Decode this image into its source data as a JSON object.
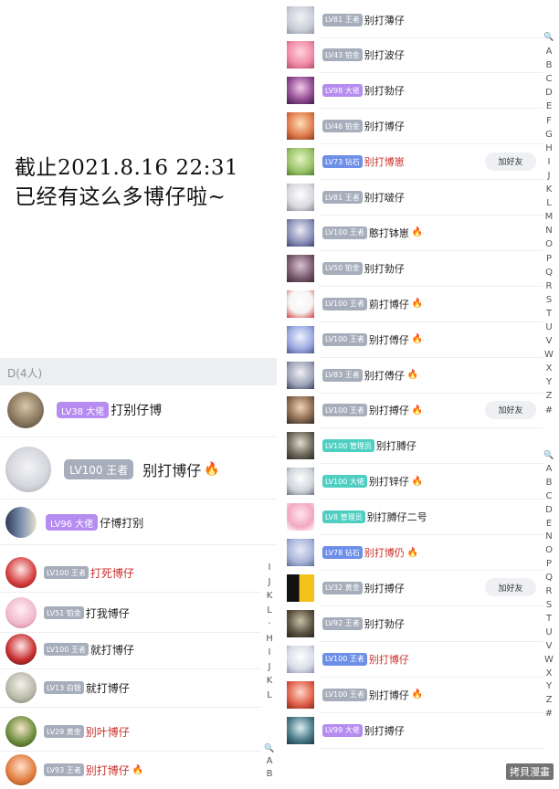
{
  "caption": {
    "line1": "截止2021.8.16 22:31",
    "line2": "已经有这么多博仔啦~"
  },
  "section_header": "D(4人)",
  "colors": {
    "purple": "#b78cf0",
    "gray": "#a6adbb",
    "teal": "#4fcfc2",
    "blue": "#6d8fe8",
    "red_name": "#c9302c"
  },
  "left_big_members": [
    {
      "badge": "LV38 大佬",
      "badge_color": "#b78cf0",
      "name": "打别仔博",
      "fire": ""
    },
    {
      "badge": "LV100 王者",
      "badge_color": "#a6adbb",
      "name": "别打博仔",
      "fire": "🔥"
    },
    {
      "badge": "LV96 大佬",
      "badge_color": "#b78cf0",
      "name": "仔博打别",
      "fire": ""
    }
  ],
  "left_small_members": [
    {
      "badge": "LV100 王者",
      "name": "打死博仔",
      "red": true,
      "fire": ""
    },
    {
      "badge": "LV51 铂金",
      "name": "打我博仔",
      "red": false,
      "fire": ""
    },
    {
      "badge": "LV100 王者",
      "name": "就打博仔",
      "red": false,
      "fire": ""
    },
    {
      "badge": "LV13 白银",
      "name": "就打博仔",
      "red": false,
      "fire": ""
    },
    {
      "badge": "LV29 黄金",
      "name": "别叶博仔",
      "red": true,
      "fire": ""
    },
    {
      "badge": "LV93 王者",
      "name": "别打博仔",
      "red": true,
      "fire": "🔥"
    }
  ],
  "left_index_letters": [
    "I",
    "J",
    "K",
    "L",
    "·",
    "H",
    "I",
    "J",
    "K",
    "L"
  ],
  "left_bottom_index": [
    "🔍",
    "A",
    "B"
  ],
  "right_members": [
    {
      "badge": "LV81 王者",
      "badge_color": "#a6adbb",
      "name": "别打薄仔",
      "red": false,
      "fire": "",
      "add": false
    },
    {
      "badge": "LV43 铂金",
      "badge_color": "#a6adbb",
      "name": "别打波仔",
      "red": false,
      "fire": "",
      "add": false
    },
    {
      "badge": "LV98 大佬",
      "badge_color": "#b78cf0",
      "name": "别打勃仔",
      "red": false,
      "fire": "",
      "add": false
    },
    {
      "badge": "LV46 铂金",
      "badge_color": "#a6adbb",
      "name": "别打博仔",
      "red": false,
      "fire": "",
      "add": false
    },
    {
      "badge": "LV73 钻石",
      "badge_color": "#6d8fe8",
      "name": "别打博崽",
      "red": true,
      "fire": "",
      "add": true
    },
    {
      "badge": "LV81 王者",
      "badge_color": "#a6adbb",
      "name": "别打啵仔",
      "red": false,
      "fire": "",
      "add": false
    },
    {
      "badge": "LV100 王者",
      "badge_color": "#a6adbb",
      "name": "憨打钵崽",
      "red": false,
      "fire": "🔥",
      "add": false
    },
    {
      "badge": "LV50 铂金",
      "badge_color": "#a6adbb",
      "name": "别打勃仔",
      "red": false,
      "fire": "",
      "add": false
    },
    {
      "badge": "LV100 王者",
      "badge_color": "#a6adbb",
      "name": "莂打博仔",
      "red": false,
      "fire": "🔥",
      "add": false
    },
    {
      "badge": "LV100 王者",
      "badge_color": "#a6adbb",
      "name": "别打傅仔",
      "red": false,
      "fire": "🔥",
      "add": false
    },
    {
      "badge": "LV83 王者",
      "badge_color": "#a6adbb",
      "name": "别打傅仔",
      "red": false,
      "fire": "🔥",
      "add": false
    },
    {
      "badge": "LV100 王者",
      "badge_color": "#a6adbb",
      "name": "别打搏仔",
      "red": false,
      "fire": "🔥",
      "add": true
    },
    {
      "badge": "LV100 管理员",
      "badge_color": "#4fcfc2",
      "name": "别打膊仔",
      "red": false,
      "fire": "",
      "add": false
    },
    {
      "badge": "LV100 大佬",
      "badge_color": "#4fcfc2",
      "name": "别打锌仔",
      "red": false,
      "fire": "🔥",
      "add": false
    },
    {
      "badge": "LV8 管理员",
      "badge_color": "#4fcfc2",
      "name": "别打膊仔二号",
      "red": false,
      "fire": "",
      "add": false
    },
    {
      "badge": "LV78 钻石",
      "badge_color": "#6d8fe8",
      "name": "别打博仍",
      "red": true,
      "fire": "🔥",
      "add": false
    },
    {
      "badge": "LV32 黄金",
      "badge_color": "#a6adbb",
      "name": "别打搏仔",
      "red": false,
      "fire": "",
      "add": true
    },
    {
      "badge": "LV92 王者",
      "badge_color": "#a6adbb",
      "name": "别打勃仔",
      "red": false,
      "fire": "",
      "add": false
    },
    {
      "badge": "LV100 王者",
      "badge_color": "#6d8fe8",
      "name": "别打博仔",
      "red": true,
      "fire": "",
      "add": false
    },
    {
      "badge": "LV100 王者",
      "badge_color": "#a6adbb",
      "name": "别打博仔",
      "red": false,
      "fire": "🔥",
      "add": false
    },
    {
      "badge": "LV99 大佬",
      "badge_color": "#b78cf0",
      "name": "别打搏仔",
      "red": false,
      "fire": "",
      "add": false
    }
  ],
  "add_friend_label": "加好友",
  "right_index_top": [
    "🔍",
    "A",
    "B",
    "C",
    "D",
    "E",
    "F",
    "G",
    "H",
    "I",
    "J",
    "K",
    "L",
    "M",
    "N",
    "O",
    "P",
    "Q",
    "R",
    "S",
    "T",
    "U",
    "V",
    "W",
    "X",
    "Y",
    "Z",
    "#"
  ],
  "right_index_bottom": [
    "🔍",
    "A",
    "B",
    "C",
    "D",
    "E",
    "N",
    "O",
    "P",
    "Q",
    "R",
    "S",
    "T",
    "U",
    "V",
    "W",
    "X",
    "Y",
    "Z",
    "#"
  ],
  "watermark": "拷貝漫畫"
}
